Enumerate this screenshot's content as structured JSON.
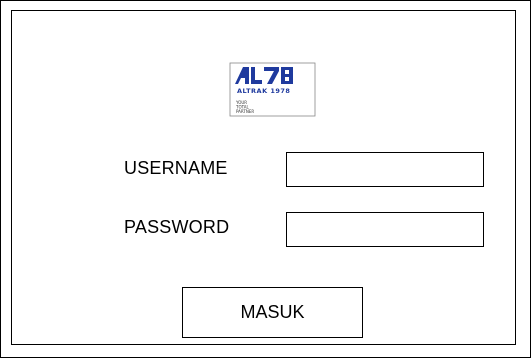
{
  "logo": {
    "brand": "ALT8",
    "name": "ALTRAK 1978",
    "tagline": "YOUR TOTAL PARTNER",
    "brand_color": "#1f3a9e"
  },
  "form": {
    "username_label": "USERNAME",
    "username_value": "",
    "password_label": "PASSWORD",
    "password_value": "",
    "submit_label": "MASUK"
  }
}
